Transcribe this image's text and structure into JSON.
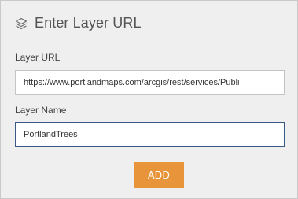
{
  "header": {
    "icon": "layers-icon",
    "title": "Enter Layer URL"
  },
  "form": {
    "url_label": "Layer URL",
    "url_value": "https://www.portlandmaps.com/arcgis/rest/services/Publi",
    "name_label": "Layer Name",
    "name_value": "PortlandTrees"
  },
  "actions": {
    "add_label": "ADD"
  },
  "colors": {
    "accent": "#e8943a",
    "focus_border": "#3a5a85",
    "background": "#efefef"
  }
}
